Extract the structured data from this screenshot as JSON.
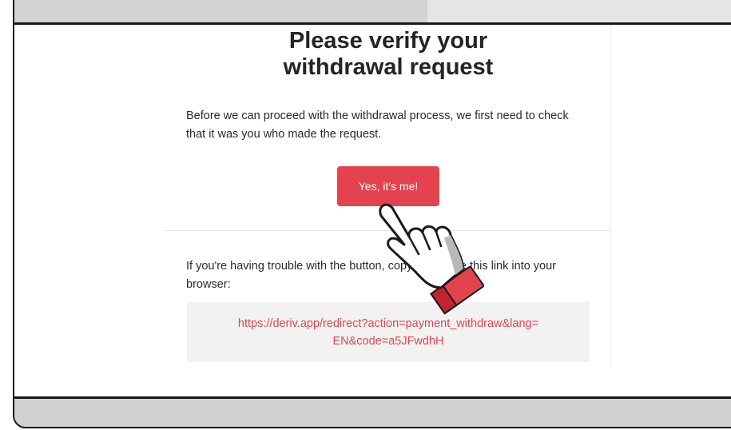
{
  "email": {
    "heading_line1": "Please verify your",
    "heading_line2": "withdrawal request",
    "intro_line1": "Before we can proceed with the withdrawal process, we first need to check",
    "intro_line2": "that it was you who made the request.",
    "confirm_button_label": "Yes, it's me!",
    "trouble_line1": "If you're having trouble with the button, copy and paste this link into your",
    "trouble_line2": "browser:",
    "link_line1": "https://deriv.app/redirect?action=payment_withdraw&lang=",
    "link_line2": "EN&code=a5JFwdhH"
  },
  "icons": {
    "window_controls": [
      "window-control-icon",
      "window-control-icon",
      "window-control-icon"
    ],
    "pointer": "pointing-hand-icon"
  },
  "colors": {
    "accent": "#e5424f",
    "accent_dark": "#c1252f",
    "frame": "#1a1a1a",
    "titlebar": "#d3d3d3"
  }
}
